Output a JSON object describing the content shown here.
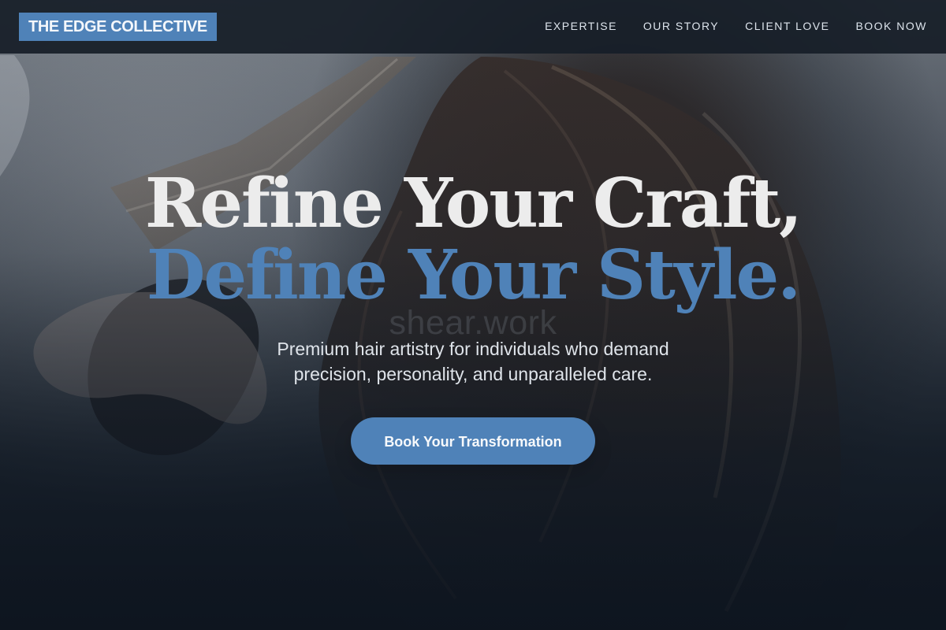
{
  "brand": {
    "name": "THE EDGE COLLECTIVE"
  },
  "nav": {
    "items": [
      {
        "label": "EXPERTISE"
      },
      {
        "label": "OUR STORY"
      },
      {
        "label": "CLIENT LOVE"
      },
      {
        "label": "BOOK NOW"
      }
    ]
  },
  "hero": {
    "headline_line_1": "Refine Your Craft,",
    "headline_line_2": "Define Your Style.",
    "watermark": "shear.work",
    "subtitle": "Premium hair artistry for individuals who demand precision, personality, and unparalleled care.",
    "cta_label": "Book Your Transformation"
  },
  "colors": {
    "accent": "#4f82b8",
    "navbar_background": "#171e28",
    "headline_text": "#ececec",
    "page_background": "#111a24"
  }
}
